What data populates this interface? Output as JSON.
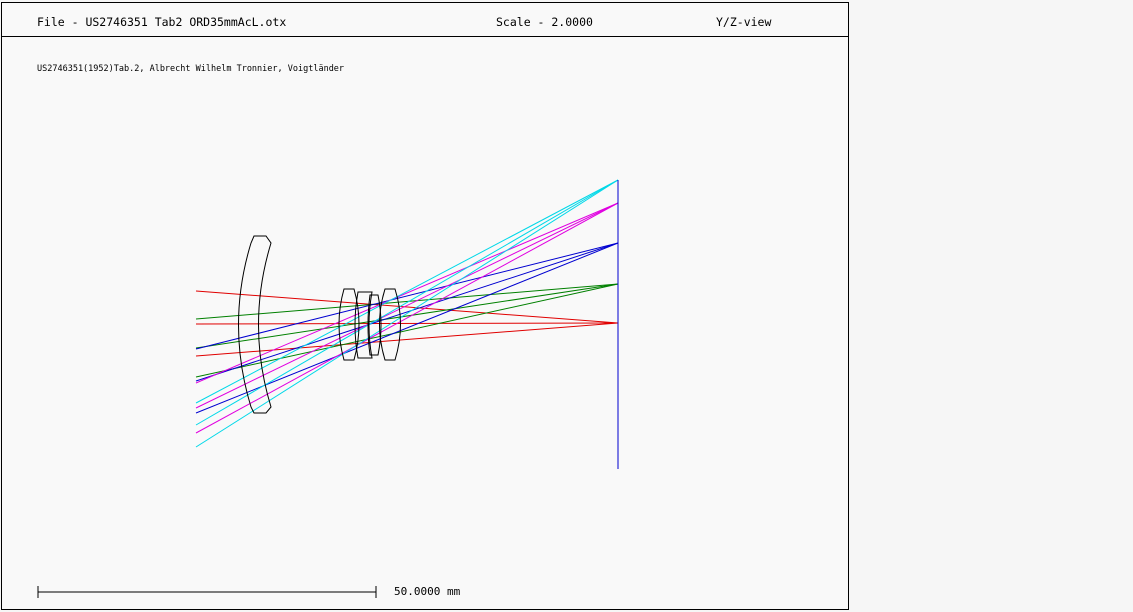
{
  "header": {
    "file_title": "File - US2746351 Tab2 ORD35mmAcL.otx",
    "scale_label": "Scale - 2.0000",
    "view_label": "Y/Z-view"
  },
  "subtitle": "US2746351(1952)Tab.2, Albrecht Wilhelm Tronnier, Voigtländer",
  "scale_bar": {
    "label": "50.0000 mm"
  },
  "colors": {
    "field_0": "#e00000",
    "field_1": "#008000",
    "field_2": "#0000d0",
    "field_3": "#e000e0",
    "field_4": "#00d8e8",
    "lens_outline": "#000000",
    "image_plane": "#0000d0"
  }
}
